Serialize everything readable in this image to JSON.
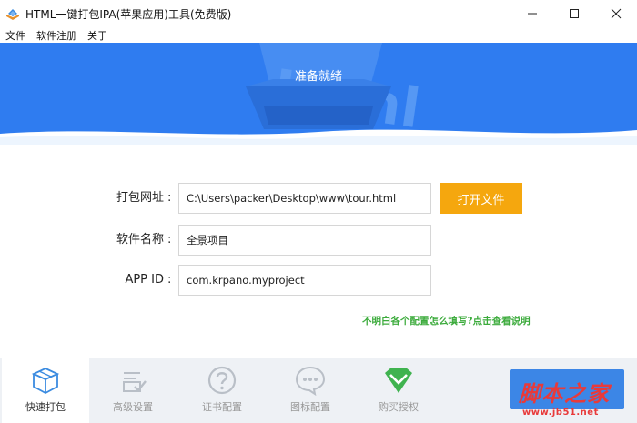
{
  "window": {
    "title": "HTML一键打包IPA(苹果应用)工具(免费版)"
  },
  "menu": {
    "items": [
      "文件",
      "软件注册",
      "关于"
    ]
  },
  "banner": {
    "status": "准备就绪",
    "logo_text": "Html"
  },
  "form": {
    "url_label": "打包网址",
    "url_value": "C:\\Users\\packer\\Desktop\\www\\tour.html",
    "open_button": "打开文件",
    "name_label": "软件名称",
    "name_value": "全景项目",
    "appid_label": "APP ID",
    "appid_value": "com.krpano.myproject",
    "colon": ":"
  },
  "help_link": "不明白各个配置怎么填写?点击查看说明",
  "tabs": [
    {
      "label": "快速打包",
      "icon": "box-icon"
    },
    {
      "label": "高级设置",
      "icon": "checklist-icon"
    },
    {
      "label": "证书配置",
      "icon": "question-icon"
    },
    {
      "label": "图标配置",
      "icon": "chat-icon"
    },
    {
      "label": "购买授权",
      "icon": "diamond-icon"
    }
  ],
  "watermark": {
    "text": "脚本之家",
    "url": "www.jb51.net"
  },
  "colors": {
    "banner": "#2f7cf0",
    "accent": "#f5a70e",
    "link": "#3cab3c",
    "active_tab_icon": "#3b8be0",
    "diamond": "#3fb34f"
  }
}
